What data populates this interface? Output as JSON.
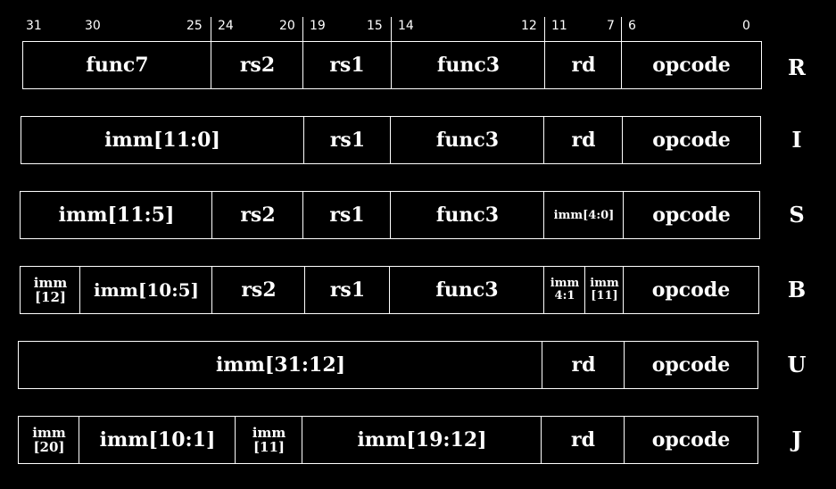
{
  "bit_labels": {
    "b31": "31",
    "b30": "30",
    "b25": "25",
    "b24": "24",
    "b20": "20",
    "b19": "19",
    "b15": "15",
    "b14": "14",
    "b12": "12",
    "b11": "11",
    "b7": "7",
    "b6": "6",
    "b0": "0"
  },
  "formats": {
    "R": {
      "label": "R",
      "fields": [
        "func7",
        "rs2",
        "rs1",
        "func3",
        "rd",
        "opcode"
      ]
    },
    "I": {
      "label": "I",
      "fields": [
        "imm[11:0]",
        "rs1",
        "func3",
        "rd",
        "opcode"
      ]
    },
    "S": {
      "label": "S",
      "fields": [
        "imm[11:5]",
        "rs2",
        "rs1",
        "func3",
        "imm[4:0]",
        "opcode"
      ]
    },
    "B": {
      "label": "B",
      "imm12_top": "imm",
      "imm12_bottom": "[12]",
      "imm10_5": "imm[10:5]",
      "rs2": "rs2",
      "rs1": "rs1",
      "func3": "func3",
      "imm4_1_top": "imm",
      "imm4_1_bottom": "4:1",
      "imm11_top": "imm",
      "imm11_bottom": "[11]",
      "opcode": "opcode"
    },
    "U": {
      "label": "U",
      "fields": [
        "imm[31:12]",
        "rd",
        "opcode"
      ]
    },
    "J": {
      "label": "J",
      "imm20_top": "imm",
      "imm20_bottom": "[20]",
      "imm10_1": "imm[10:1]",
      "imm11_top": "imm",
      "imm11_bottom": "[11]",
      "imm19_12": "imm[19:12]",
      "rd": "rd",
      "opcode": "opcode"
    }
  }
}
